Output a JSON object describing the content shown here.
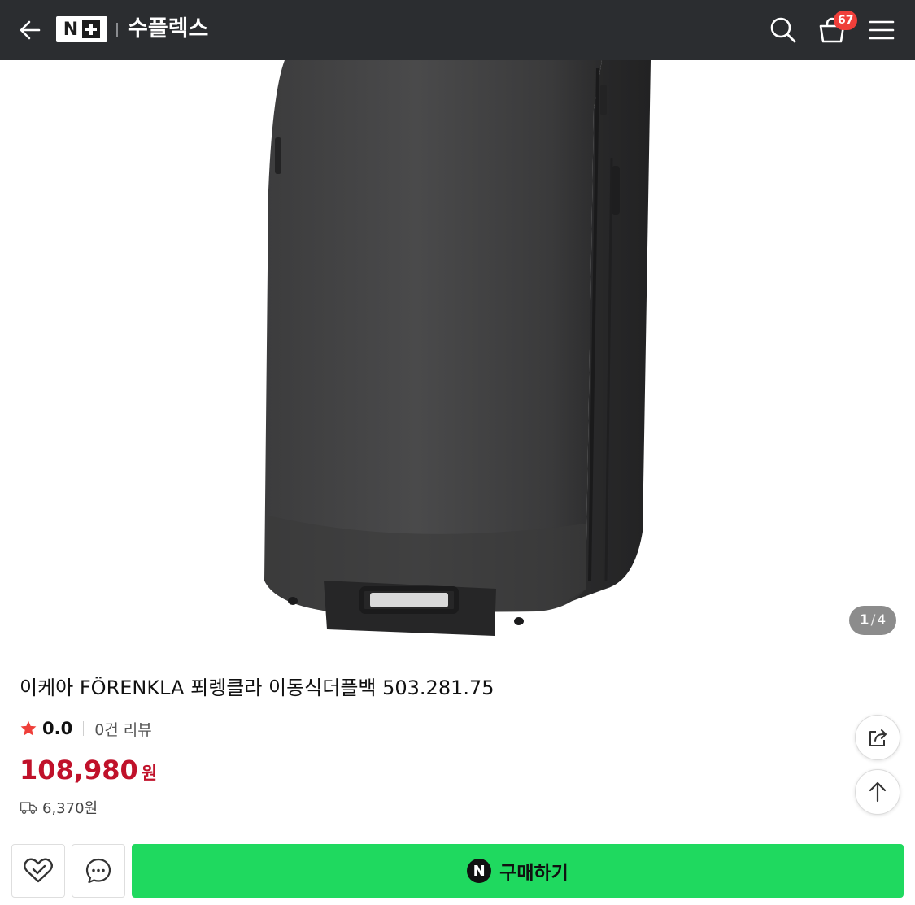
{
  "header": {
    "logo_text": "N",
    "store_name": "수플렉스",
    "cart_count": "67",
    "icons": [
      "back-arrow-icon",
      "search-icon",
      "cart-icon",
      "hamburger-menu-icon"
    ]
  },
  "gallery": {
    "current_page": "1",
    "separator": "/",
    "total_pages": "4",
    "image_subject": "product-photo"
  },
  "product": {
    "title": "이케아 FÖRENKLA 푀렝클라 이동식더플백 503.281.75",
    "rating": "0.0",
    "review_count": "0건 리뷰",
    "price": "108,980",
    "currency": "원",
    "shipping_fee": "6,370원"
  },
  "floating": {
    "share_icon": "share-icon",
    "top_icon": "arrow-up-icon"
  },
  "bottom_bar": {
    "npay_letter": "N",
    "buy_label": "구매하기",
    "wish_icon": "heart-check-icon",
    "talk_icon": "chat-bubble-icon"
  },
  "colors": {
    "header_bg": "#2b2d30",
    "price": "#c0112a",
    "buy_button": "#1fd95f",
    "badge": "#ef3f3a",
    "star": "#ef3f3a"
  }
}
